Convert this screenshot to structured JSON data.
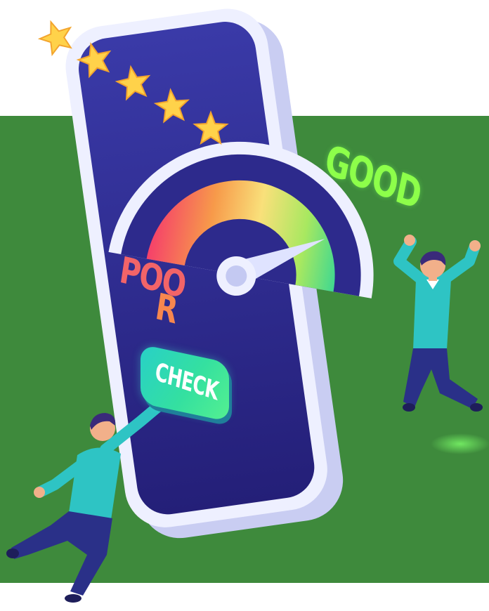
{
  "texts": {
    "good": "GOOD",
    "poor_line1": "POO",
    "poor_line2": "R",
    "check": "CHECK"
  },
  "rating": {
    "stars": 5
  },
  "gauge": {
    "needle": "good",
    "gradient": [
      "#f5406a",
      "#f79a4a",
      "#f9e07a",
      "#a8e860",
      "#40d890"
    ]
  },
  "colors": {
    "green_band": "#3e8a3c",
    "phone_screen": "#2d2a8c",
    "phone_frame": "#eef0ff",
    "star": "#ffd24a",
    "good": "#8dff4a",
    "poor": "#f26468",
    "button": "#2fd6b8",
    "shirt": "#2ec4c4",
    "pants": "#2a3088",
    "hair": "#3a2a7a"
  }
}
